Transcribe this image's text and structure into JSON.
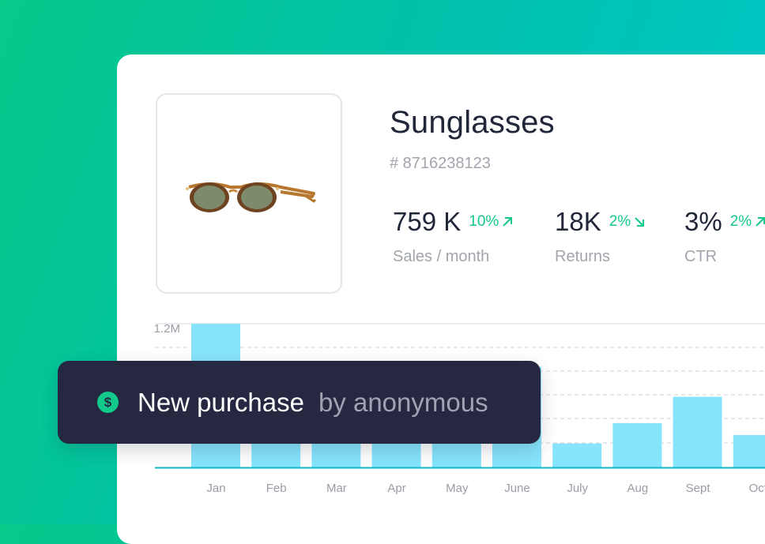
{
  "product": {
    "name": "Sunglasses",
    "sku": "# 8716238123",
    "image_icon": "sunglasses-image"
  },
  "stats": [
    {
      "value": "759 K",
      "delta": "10%",
      "trend": "up",
      "label": "Sales / month"
    },
    {
      "value": "18K",
      "delta": "2%",
      "trend": "down",
      "label": "Returns"
    },
    {
      "value": "3%",
      "delta": "2%",
      "trend": "up",
      "label": "CTR"
    }
  ],
  "colors": {
    "accent": "#11c98a",
    "bar": "#86e4fc",
    "toast_bg": "#252840",
    "text_dark": "#222639",
    "text_muted": "#a2a5ad"
  },
  "chart_data": {
    "type": "bar",
    "categories": [
      "Jan",
      "Feb",
      "Mar",
      "Apr",
      "May",
      "June",
      "July",
      "Aug",
      "Sept",
      "Oct"
    ],
    "values": [
      1.2,
      0.6,
      0.57,
      0.6,
      0.6,
      0.84,
      0.2,
      0.37,
      0.59,
      0.27
    ],
    "y_tick_label": "1.2M",
    "ylim": [
      0,
      1.2
    ],
    "grid": true,
    "title": "",
    "xlabel": "",
    "ylabel": ""
  },
  "toast": {
    "icon": "dollar-icon",
    "icon_glyph": "$",
    "message": "New purchase",
    "by": "by anonymous"
  }
}
